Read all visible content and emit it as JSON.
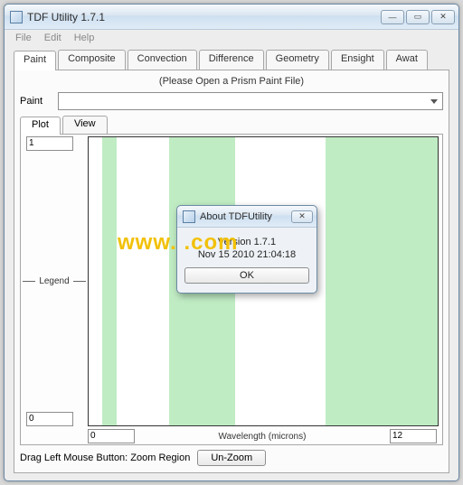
{
  "window": {
    "title": "TDF Utility 1.7.1",
    "buttons": {
      "min": "—",
      "max": "▭",
      "close": "✕"
    }
  },
  "menu": {
    "file": "File",
    "edit": "Edit",
    "help": "Help"
  },
  "tabs": {
    "paint": "Paint",
    "composite": "Composite",
    "convection": "Convection",
    "difference": "Difference",
    "geometry": "Geometry",
    "ensight": "Ensight",
    "awat": "Awat"
  },
  "hint": "(Please Open a Prism Paint File)",
  "paint_label": "Paint",
  "sub_tabs": {
    "plot": "Plot",
    "view": "View"
  },
  "y_top": "1",
  "y_bottom": "0",
  "legend_label": "Legend",
  "x_min": "0",
  "x_max": "12",
  "x_label": "Wavelength (microns)",
  "status_hint": "Drag Left Mouse Button: Zoom Region",
  "unzoom_label": "Un-Zoom",
  "about": {
    "title": "About TDFUtility",
    "version_line": "Version 1.7.1",
    "date_line": "Nov 15 2010 21:04:18",
    "ok": "OK",
    "close": "✕"
  },
  "watermark": "www.                        .com",
  "chart_data": {
    "type": "area",
    "xlabel": "Wavelength (microns)",
    "ylabel": "",
    "xlim": [
      0,
      12
    ],
    "ylim": [
      0,
      1
    ],
    "bands": [
      {
        "x0": 0.5,
        "x1": 0.9,
        "color": "#c0ecc4"
      },
      {
        "x0": 2.8,
        "x1": 5.0,
        "color": "#c0ecc4"
      },
      {
        "x0": 8.2,
        "x1": 12.0,
        "color": "#c0ecc4"
      }
    ],
    "legend": [
      "Legend"
    ]
  }
}
